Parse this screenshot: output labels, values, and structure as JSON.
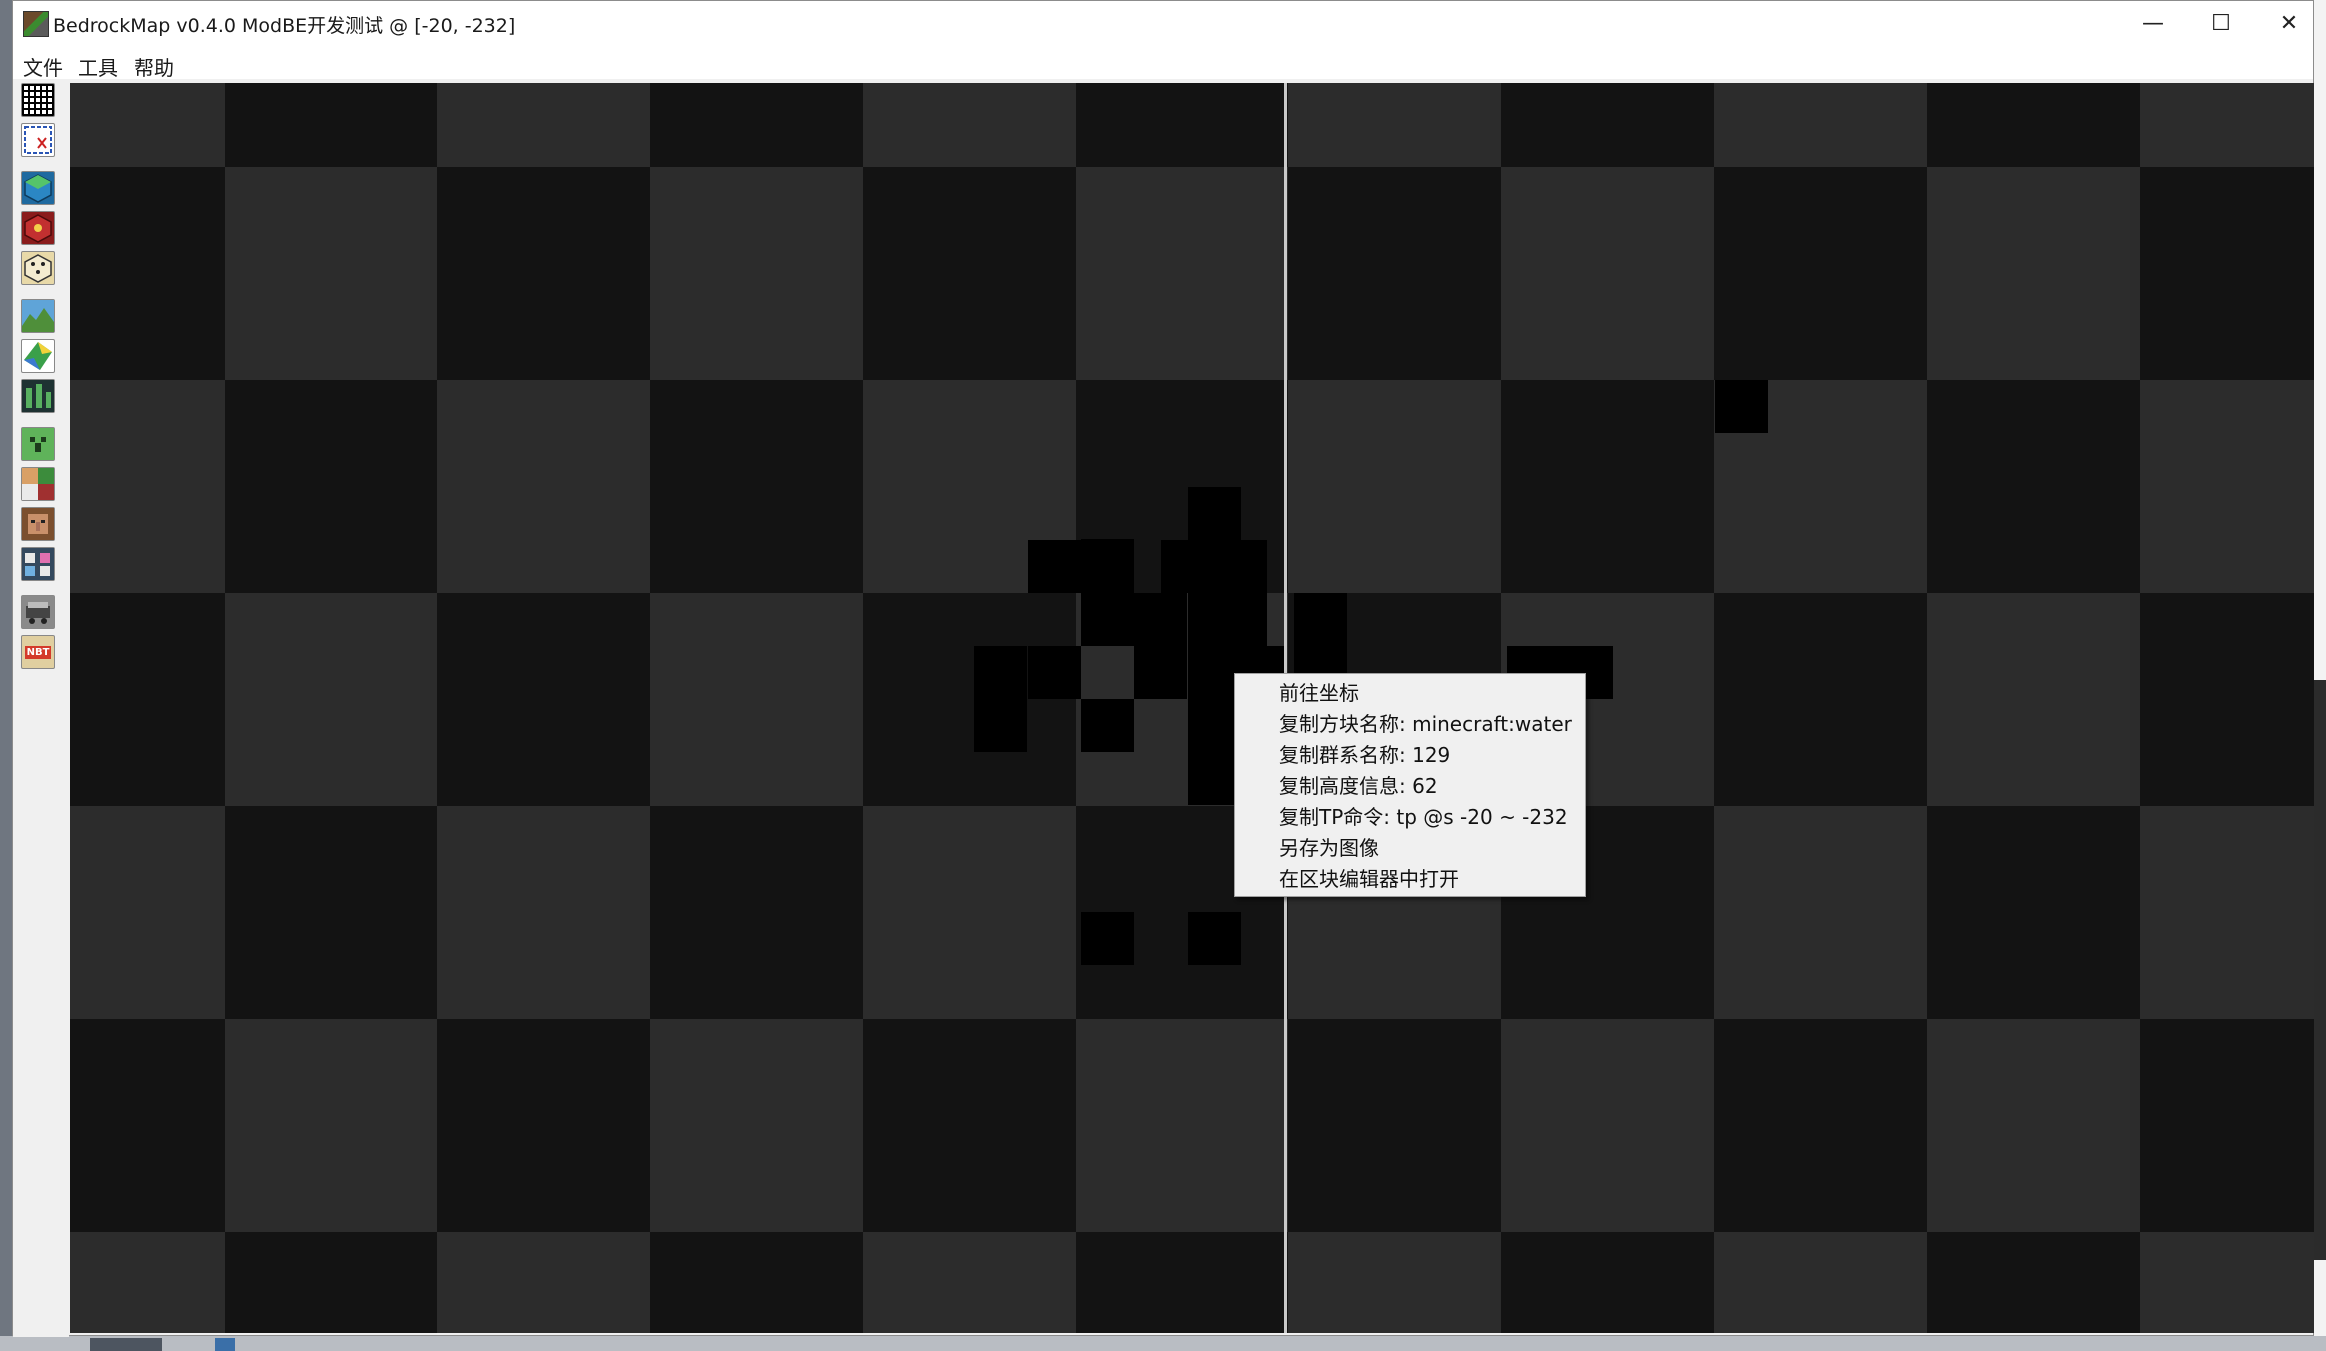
{
  "window": {
    "title": "BedrockMap v0.4.0 ModBE开发测试 @  [-20, -232]",
    "controls": {
      "minimize": "—",
      "maximize": "☐",
      "close": "✕"
    }
  },
  "menu": [
    "文件",
    "工具",
    "帮助"
  ],
  "toolbar": {
    "tools": [
      {
        "icon": "grid-icon"
      },
      {
        "icon": "chunk-select-icon"
      },
      {
        "icon": "world-cube-icon"
      },
      {
        "icon": "redstone-block-icon"
      },
      {
        "icon": "dice-icon"
      },
      {
        "icon": "terrain-icon"
      },
      {
        "icon": "biome-map-icon"
      },
      {
        "icon": "slime-chunk-icon"
      },
      {
        "icon": "creeper-icon"
      },
      {
        "icon": "entities-icon"
      },
      {
        "icon": "villager-icon"
      },
      {
        "icon": "actors-icon"
      },
      {
        "icon": "minecart-icon"
      },
      {
        "icon": "nbt-icon",
        "label": "NBT"
      }
    ]
  },
  "context_menu": {
    "items": [
      "前往坐标",
      "复制方块名称: minecraft:water",
      "复制群系名称: 129",
      "复制高度信息: 62",
      "复制TP命令: tp @s -20 ~ -232",
      "另存为图像",
      "在区块编辑器中打开"
    ]
  },
  "colors": {
    "chunk_light": "#2c2c2c",
    "chunk_dark": "#131313",
    "block": "#000000",
    "crosshair": "#c9c9c9"
  }
}
